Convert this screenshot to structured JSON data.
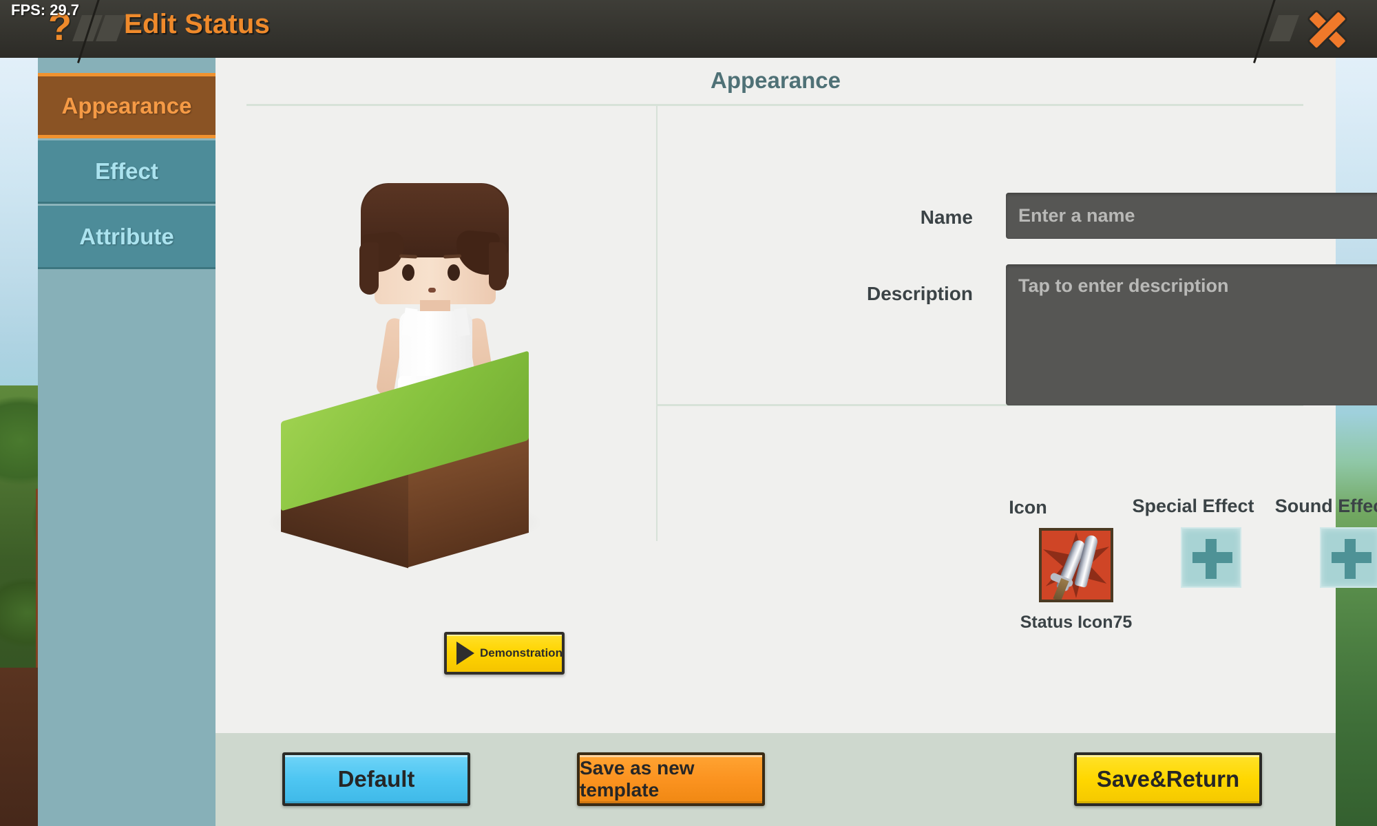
{
  "topbar": {
    "fps": "FPS: 29.7",
    "help_icon": "?",
    "title": "Edit Status",
    "close_icon": "close-x"
  },
  "sidebar": {
    "tabs": [
      {
        "label": "Appearance",
        "active": true
      },
      {
        "label": "Effect",
        "active": false
      },
      {
        "label": "Attribute",
        "active": false
      }
    ]
  },
  "panel": {
    "heading": "Appearance",
    "preview": {
      "demo_button_label": "Demonstration",
      "demo_play_icon": "play-triangle-icon"
    },
    "form": {
      "name_label": "Name",
      "name_value": "",
      "name_placeholder": "Enter a name",
      "description_label": "Description",
      "description_value": "",
      "description_placeholder": "Tap to enter description"
    },
    "slots": {
      "icon_title": "Icon",
      "icon_caption": "Status Icon75",
      "icon_art": "crossed-daggers-red-icon",
      "special_effect_title": "Special Effect",
      "special_effect_add_icon": "plus-icon",
      "sound_effect_title": "Sound Effect",
      "sound_effect_add_icon": "plus-icon"
    },
    "footer": {
      "default_label": "Default",
      "template_label": "Save as new template",
      "save_return_label": "Save&Return"
    }
  },
  "colors": {
    "topbar_bg": "#36352f",
    "accent_orange": "#ef8a2b",
    "tab_active_bg": "#8a5324",
    "tab_inactive_bg": "#4d8c99",
    "sidebar_bg": "#87b0b8",
    "panel_bg": "#f0f0ee",
    "heading_text": "#4f7176",
    "input_bg": "#565654",
    "footer_bg": "#ced8ce",
    "default_button": "#4ec6f2",
    "template_button": "#fb9320",
    "save_button": "#ffd700",
    "slot_teal": "#a8d3d4",
    "icon_red": "#cf4526"
  }
}
